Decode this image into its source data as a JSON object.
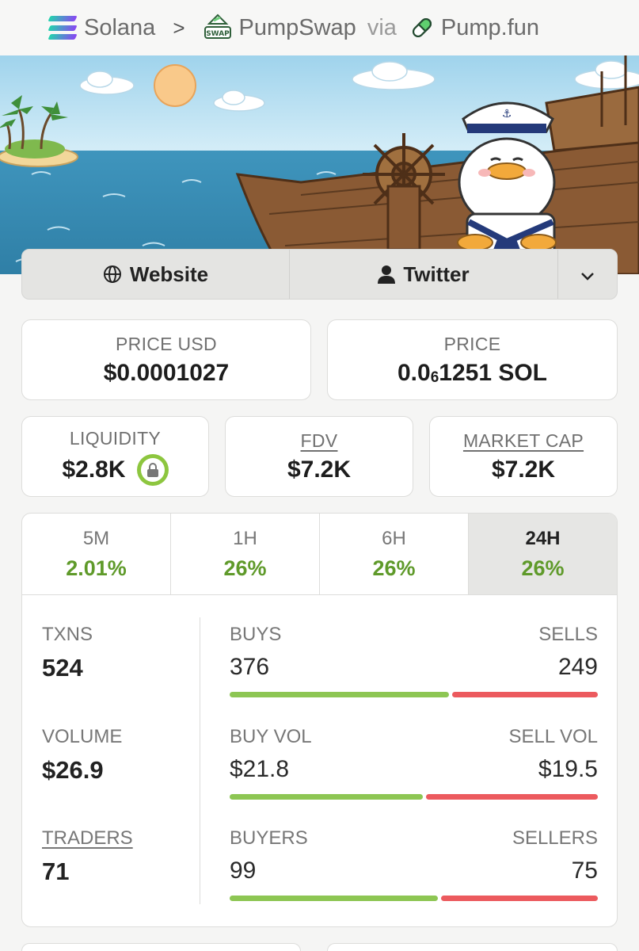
{
  "breadcrumb": {
    "chain": "Solana",
    "separator": ">",
    "dex": "PumpSwap",
    "dex_icon_text": "SWAP",
    "via": "via",
    "launchpad": "Pump.fun"
  },
  "links": {
    "website": "Website",
    "twitter": "Twitter"
  },
  "price_usd": {
    "label": "PRICE USD",
    "value": "$0.0001027"
  },
  "price_native": {
    "label": "PRICE",
    "prefix": "0.0",
    "sub": "6",
    "suffix": "1251 SOL"
  },
  "liquidity": {
    "label": "LIQUIDITY",
    "value": "$2.8K"
  },
  "fdv": {
    "label": "FDV",
    "value": "$7.2K"
  },
  "market_cap": {
    "label": "MARKET CAP",
    "value": "$7.2K"
  },
  "tabs": [
    {
      "label": "5M",
      "value": "2.01%"
    },
    {
      "label": "1H",
      "value": "26%"
    },
    {
      "label": "6H",
      "value": "26%"
    },
    {
      "label": "24H",
      "value": "26%",
      "active": true
    }
  ],
  "txns": {
    "label": "TXNS",
    "value": "524"
  },
  "volume": {
    "label": "VOLUME",
    "value": "$26.9"
  },
  "traders": {
    "label": "TRADERS",
    "value": "71"
  },
  "buys_sells": {
    "buy_label": "BUYS",
    "sell_label": "SELLS",
    "buy_value": "376",
    "sell_value": "249",
    "buy_fraction": 0.6
  },
  "vol_split": {
    "buy_label": "BUY VOL",
    "sell_label": "SELL VOL",
    "buy_value": "$21.8",
    "sell_value": "$19.5",
    "buy_fraction": 0.53
  },
  "buyers_sellers": {
    "buy_label": "BUYERS",
    "sell_label": "SELLERS",
    "buy_value": "99",
    "sell_value": "75",
    "buy_fraction": 0.57
  },
  "colors": {
    "positive": "#5f9a2a",
    "buy_bar": "#8dc653",
    "sell_bar": "#ec5a5e",
    "lock_badge": "#8dc63f"
  }
}
